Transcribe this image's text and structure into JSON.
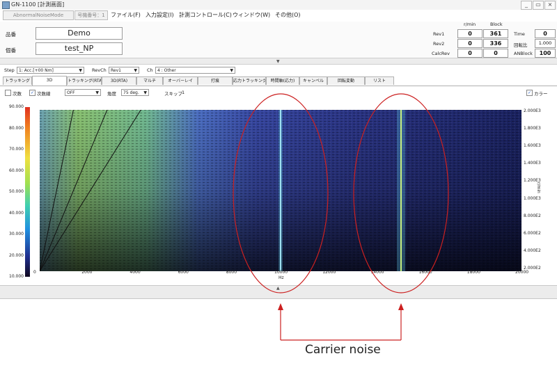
{
  "window": {
    "title": "GN-1100 [計測画面]",
    "buttons": [
      "_",
      "▭",
      "×"
    ]
  },
  "menubar": {
    "mode": "AbnormalNoiseMode",
    "form_number": "号機番号：1",
    "items": [
      "ファイル(F)",
      "入力設定(I)",
      "計測コントロール(C)",
      "ウィンドウ(W)",
      "その他(O)"
    ]
  },
  "header": {
    "part_label": "品番",
    "part_value": "Demo",
    "sub_label": "個番",
    "sub_value": "test_NP",
    "col_rmin": "r/min",
    "col_block": "Block",
    "rows": [
      {
        "label": "Rev1",
        "rmin": "0",
        "block": "361"
      },
      {
        "label": "Rev2",
        "rmin": "0",
        "block": "336"
      },
      {
        "label": "CalcRev",
        "rmin": "0",
        "block": "0"
      }
    ],
    "right": [
      {
        "label": "Time",
        "value": "0"
      },
      {
        "label": "回転比",
        "value": "1.000"
      },
      {
        "label": "ANBlock",
        "value": "100"
      }
    ]
  },
  "toolbar": {
    "step_label": "Step",
    "step_value": "1: Acc.[+00 Nm]",
    "revch_label": "RevCh",
    "revch_value": "Rev1",
    "ch_label": "Ch",
    "ch_value": "4 : Other"
  },
  "tabs": [
    "トラッキング",
    "3D",
    "トラッキング(RTA)",
    "3D(RTA)",
    "マルチ",
    "オーバーレイ",
    "打痕",
    "応力トラッキング",
    "時間軸(応力)",
    "キャンペル",
    "回転変動",
    "リスト"
  ],
  "active_tab_index": 1,
  "options": {
    "order_label": "次数",
    "order_checked": false,
    "order_line_label": "次数線",
    "order_line_checked": true,
    "order_select": "OFF",
    "angle_label": "角度",
    "angle_value": "75 deg.",
    "skip_label": "スキップ",
    "skip_value": "1",
    "color_label": "カラー",
    "color_checked": true
  },
  "chart_data": {
    "type": "heatmap",
    "title": "",
    "xlabel": "Hz",
    "ylabel_right": "r/min",
    "x_ticks": [
      "0",
      "2000",
      "4000",
      "6000",
      "8000",
      "10000",
      "12000",
      "14000",
      "16000",
      "18000",
      "20000"
    ],
    "xlim": [
      0,
      20000
    ],
    "colorbar_ticks": [
      "90.000",
      "80.000",
      "70.000",
      "60.000",
      "50.000",
      "40.000",
      "30.000",
      "20.000",
      "10.000"
    ],
    "colorbar_range": [
      10,
      90
    ],
    "y_right_ticks": [
      "2.000E3",
      "1.800E3",
      "1.600E3",
      "1.400E3",
      "1.200E3",
      "1.000E3",
      "8.000E2",
      "6.000E2",
      "4.000E2",
      "2.000E2"
    ],
    "ylim": [
      200,
      2000
    ],
    "colors": {
      "low": "#0a0c2a",
      "mid": "#3a56b8",
      "high": "#f0e040",
      "peak": "#e03020"
    },
    "order_lines": [
      {
        "x_at_top": 1400
      },
      {
        "x_at_top": 2800
      },
      {
        "x_at_top": 4200
      }
    ],
    "carrier_noise_lines_hz": [
      10000,
      15000
    ]
  },
  "annotation": {
    "text": "Carrier noise",
    "color": "#cc2020"
  }
}
